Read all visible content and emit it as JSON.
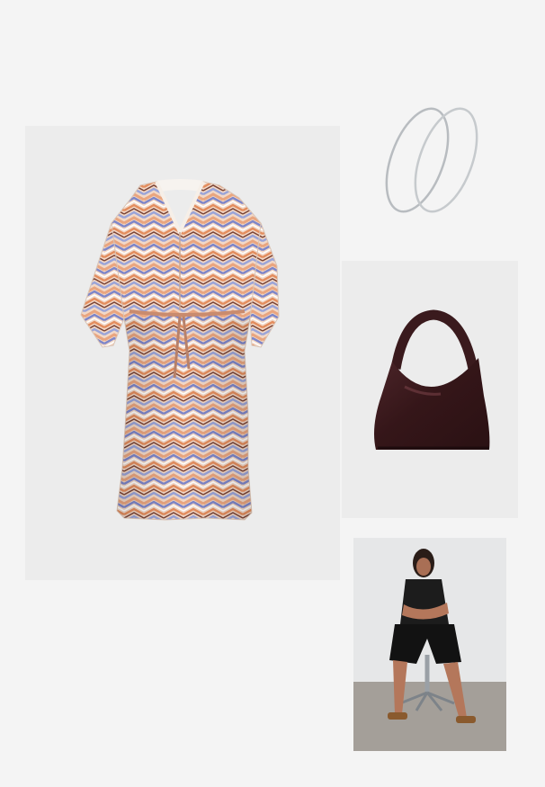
{
  "page": {
    "background": "#f4f4f4"
  },
  "items": [
    {
      "key": "dress",
      "name": "zigzag-print-shirt-dress",
      "colors": [
        "#e9a57f",
        "#7e86c9",
        "#f2d8c7",
        "#7a4335"
      ]
    },
    {
      "key": "earrings",
      "name": "silver-hoop-earrings",
      "colors": [
        "#b8bcc0"
      ]
    },
    {
      "key": "bag",
      "name": "burgundy-leather-hobo-bag",
      "colors": [
        "#3a1a1d"
      ]
    },
    {
      "key": "model",
      "name": "model-in-black-outfit-on-stool",
      "colors": [
        "#1c1c1c",
        "#b4775b",
        "#a49f99"
      ]
    }
  ]
}
